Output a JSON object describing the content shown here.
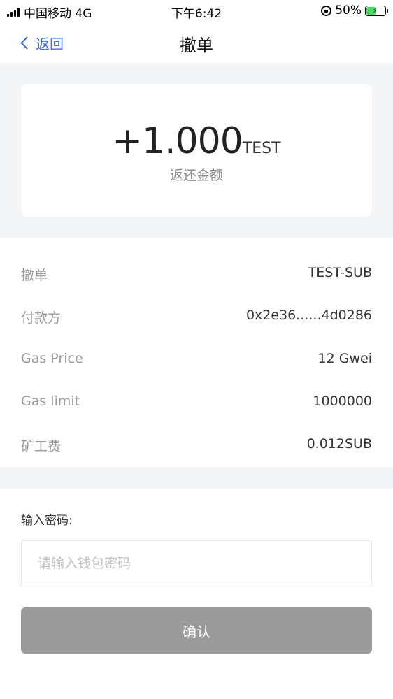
{
  "status_bar": {
    "carrier": "中国移动 4G",
    "time": "下午6:42",
    "battery": "50%",
    "battery_level": 0.5
  },
  "nav": {
    "back_label": "返回",
    "title": "撤单"
  },
  "amount": {
    "value": "+1.000",
    "unit": "TEST",
    "label": "返还金额"
  },
  "details": {
    "rows": [
      {
        "label": "撤单",
        "value": "TEST-SUB"
      },
      {
        "label": "付款方",
        "value": "0x2e36......4d0286"
      },
      {
        "label": "Gas Price",
        "value": "12 Gwei"
      },
      {
        "label": "Gas limit",
        "value": "1000000"
      },
      {
        "label": "矿工费",
        "value": "0.012SUB"
      }
    ]
  },
  "password": {
    "label": "输入密码:",
    "placeholder": "请输入钱包密码",
    "value": ""
  },
  "confirm_button": {
    "label": "确认",
    "color": "#9b9b9b"
  },
  "colors": {
    "accent": "#3b6fd6",
    "background_gray": "#f4f5f7",
    "battery_fill": "#4cd964"
  }
}
